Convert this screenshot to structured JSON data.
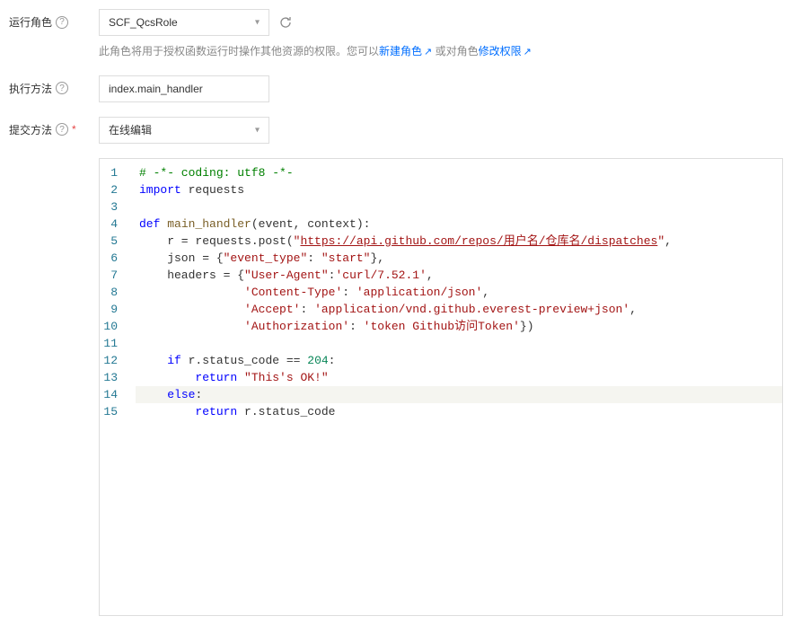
{
  "labels": {
    "runRole": "运行角色",
    "execMethod": "执行方法",
    "submitMethod": "提交方法"
  },
  "runRole": {
    "value": "SCF_QcsRole",
    "hint_prefix": "此角色将用于授权函数运行时操作其他资源的权限。您可以",
    "link_create": "新建角色",
    "hint_mid": " 或对角色",
    "link_modify": "修改权限"
  },
  "execMethod": {
    "value": "index.main_handler"
  },
  "submitMethod": {
    "value": "在线编辑"
  },
  "code": {
    "lines": [
      [
        {
          "t": "comment",
          "v": "# -*- coding: utf8 -*-"
        }
      ],
      [
        {
          "t": "keyword",
          "v": "import"
        },
        {
          "t": "plain",
          "v": " requests"
        }
      ],
      [],
      [
        {
          "t": "keyword",
          "v": "def"
        },
        {
          "t": "plain",
          "v": " "
        },
        {
          "t": "funcname",
          "v": "main_handler"
        },
        {
          "t": "plain",
          "v": "(event, context):"
        }
      ],
      [
        {
          "t": "plain",
          "v": "    r = requests.post("
        },
        {
          "t": "string",
          "v": "\""
        },
        {
          "t": "string-link",
          "v": "https://api.github.com/repos/用户名/仓库名/dispatches"
        },
        {
          "t": "string",
          "v": "\""
        },
        {
          "t": "plain",
          "v": ","
        }
      ],
      [
        {
          "t": "plain",
          "v": "    json = {"
        },
        {
          "t": "string",
          "v": "\"event_type\""
        },
        {
          "t": "plain",
          "v": ": "
        },
        {
          "t": "string",
          "v": "\"start\""
        },
        {
          "t": "plain",
          "v": "},"
        }
      ],
      [
        {
          "t": "plain",
          "v": "    headers = {"
        },
        {
          "t": "string",
          "v": "\"User-Agent\""
        },
        {
          "t": "plain",
          "v": ":"
        },
        {
          "t": "string",
          "v": "'curl/7.52.1'"
        },
        {
          "t": "plain",
          "v": ","
        }
      ],
      [
        {
          "t": "plain",
          "v": "               "
        },
        {
          "t": "string",
          "v": "'Content-Type'"
        },
        {
          "t": "plain",
          "v": ": "
        },
        {
          "t": "string",
          "v": "'application/json'"
        },
        {
          "t": "plain",
          "v": ","
        }
      ],
      [
        {
          "t": "plain",
          "v": "               "
        },
        {
          "t": "string",
          "v": "'Accept'"
        },
        {
          "t": "plain",
          "v": ": "
        },
        {
          "t": "string",
          "v": "'application/vnd.github.everest-preview+json'"
        },
        {
          "t": "plain",
          "v": ","
        }
      ],
      [
        {
          "t": "plain",
          "v": "               "
        },
        {
          "t": "string",
          "v": "'Authorization'"
        },
        {
          "t": "plain",
          "v": ": "
        },
        {
          "t": "string",
          "v": "'token Github访问Token'"
        },
        {
          "t": "plain",
          "v": "})"
        }
      ],
      [],
      [
        {
          "t": "plain",
          "v": "    "
        },
        {
          "t": "keyword",
          "v": "if"
        },
        {
          "t": "plain",
          "v": " r.status_code == "
        },
        {
          "t": "number",
          "v": "204"
        },
        {
          "t": "plain",
          "v": ":"
        }
      ],
      [
        {
          "t": "plain",
          "v": "        "
        },
        {
          "t": "keyword",
          "v": "return"
        },
        {
          "t": "plain",
          "v": " "
        },
        {
          "t": "string",
          "v": "\"This's OK!\""
        }
      ],
      [
        {
          "t": "plain",
          "v": "    "
        },
        {
          "t": "keyword",
          "v": "else"
        },
        {
          "t": "plain",
          "v": ":"
        }
      ],
      [
        {
          "t": "plain",
          "v": "        "
        },
        {
          "t": "keyword",
          "v": "return"
        },
        {
          "t": "plain",
          "v": " r.status_code"
        }
      ]
    ],
    "highlighted_line": 14
  }
}
